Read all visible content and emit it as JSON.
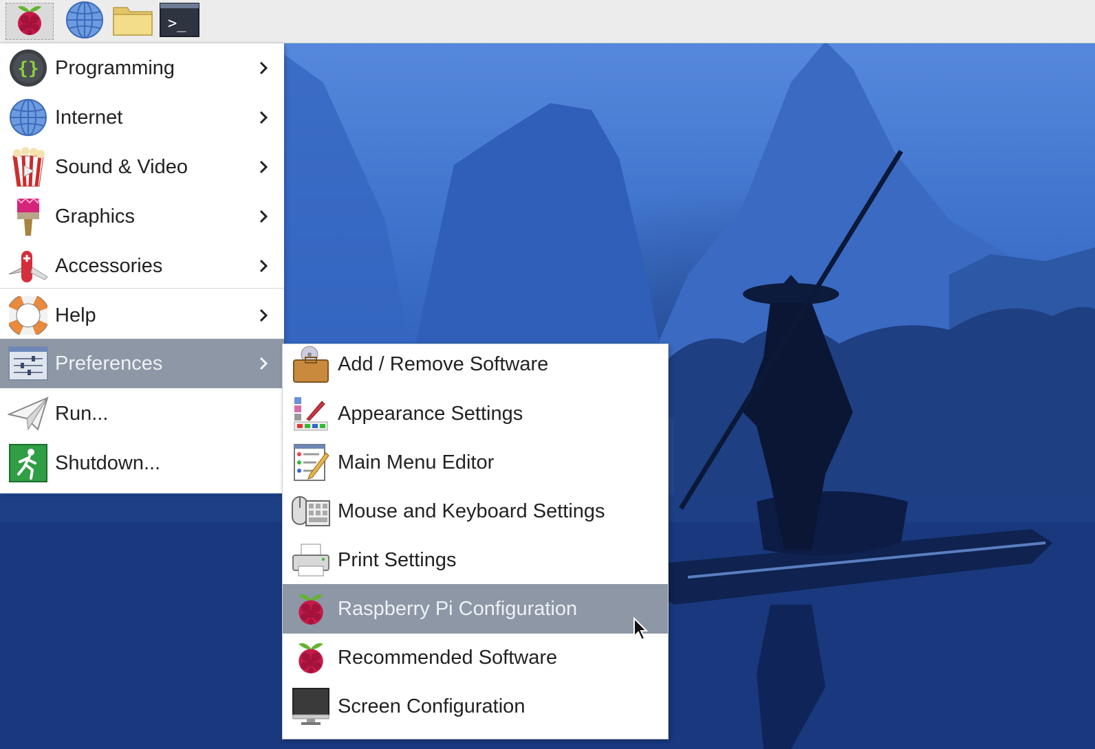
{
  "taskbar": {
    "buttons": [
      {
        "name": "raspberry-menu-button",
        "icon": "raspberry-icon"
      },
      {
        "name": "web-browser-button",
        "icon": "globe-icon"
      },
      {
        "name": "file-manager-button",
        "icon": "folder-icon"
      },
      {
        "name": "terminal-button",
        "icon": "terminal-icon"
      }
    ],
    "terminal_prompt": ">_"
  },
  "main_menu": {
    "items": [
      {
        "label": "Programming",
        "icon": "code-braces-icon",
        "submenu": true
      },
      {
        "label": "Internet",
        "icon": "globe-icon",
        "submenu": true
      },
      {
        "label": "Sound & Video",
        "icon": "popcorn-icon",
        "submenu": true
      },
      {
        "label": "Graphics",
        "icon": "paintbrush-icon",
        "submenu": true
      },
      {
        "label": "Accessories",
        "icon": "pocket-knife-icon",
        "submenu": true
      },
      {
        "label": "Help",
        "icon": "lifebuoy-icon",
        "submenu": true
      },
      {
        "label": "Preferences",
        "icon": "sliders-icon",
        "submenu": true,
        "highlighted": true
      },
      {
        "label": "Run...",
        "icon": "paper-plane-icon",
        "submenu": false
      },
      {
        "label": "Shutdown...",
        "icon": "exit-running-man-icon",
        "submenu": false
      }
    ]
  },
  "preferences_menu": {
    "items": [
      {
        "label": "Add / Remove Software",
        "icon": "package-icon"
      },
      {
        "label": "Appearance Settings",
        "icon": "palette-icon"
      },
      {
        "label": "Main Menu Editor",
        "icon": "menu-editor-icon"
      },
      {
        "label": "Mouse and Keyboard Settings",
        "icon": "mouse-keyboard-icon"
      },
      {
        "label": "Print Settings",
        "icon": "printer-icon"
      },
      {
        "label": "Raspberry Pi Configuration",
        "icon": "raspberry-icon",
        "highlighted": true
      },
      {
        "label": "Recommended Software",
        "icon": "raspberry-icon"
      },
      {
        "label": "Screen Configuration",
        "icon": "monitor-icon"
      }
    ]
  },
  "colors": {
    "highlight": "#8d97a6",
    "taskbar": "#ececec",
    "menu_bg": "#ffffff",
    "desktop_blue": "#3f73cc"
  }
}
